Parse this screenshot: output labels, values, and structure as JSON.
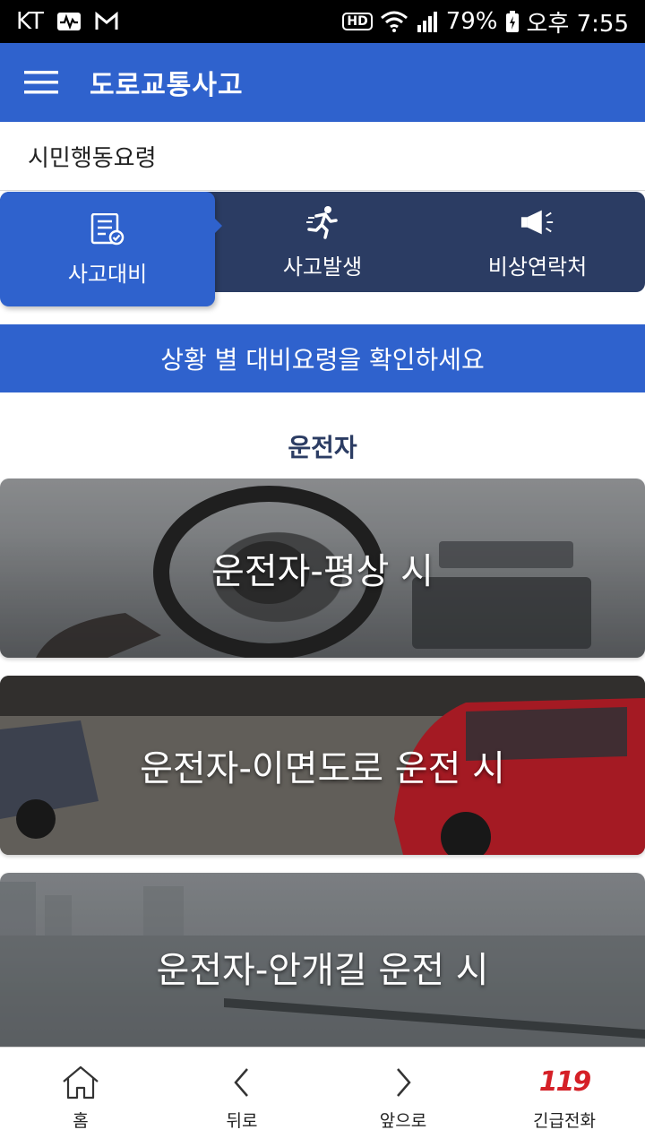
{
  "status_bar": {
    "carrier": "KT",
    "hd": "HD",
    "battery": "79%",
    "time": "오후 7:55"
  },
  "app_bar": {
    "title": "도로교통사고"
  },
  "sub_header": {
    "title": "시민행동요령"
  },
  "tabs": [
    {
      "label": "사고대비",
      "icon": "checklist-icon",
      "active": true
    },
    {
      "label": "사고발생",
      "icon": "running-person-icon",
      "active": false
    },
    {
      "label": "비상연락처",
      "icon": "megaphone-icon",
      "active": false
    }
  ],
  "banner": {
    "text": "상황 별 대비요령을 확인하세요"
  },
  "section": {
    "title": "운전자"
  },
  "cards": [
    {
      "title": "운전자-평상 시"
    },
    {
      "title": "운전자-이면도로 운전 시"
    },
    {
      "title": "운전자-안개길 운전 시"
    }
  ],
  "bottom_nav": [
    {
      "label": "홈",
      "icon": "home-icon"
    },
    {
      "label": "뒤로",
      "icon": "chevron-left-icon"
    },
    {
      "label": "앞으로",
      "icon": "chevron-right-icon"
    },
    {
      "label": "긴급전화",
      "icon": "emergency-119-icon",
      "logo_text": "119"
    }
  ],
  "colors": {
    "primary": "#2f62cd",
    "tab_bar": "#2b3c63",
    "emergency": "#d52027"
  }
}
